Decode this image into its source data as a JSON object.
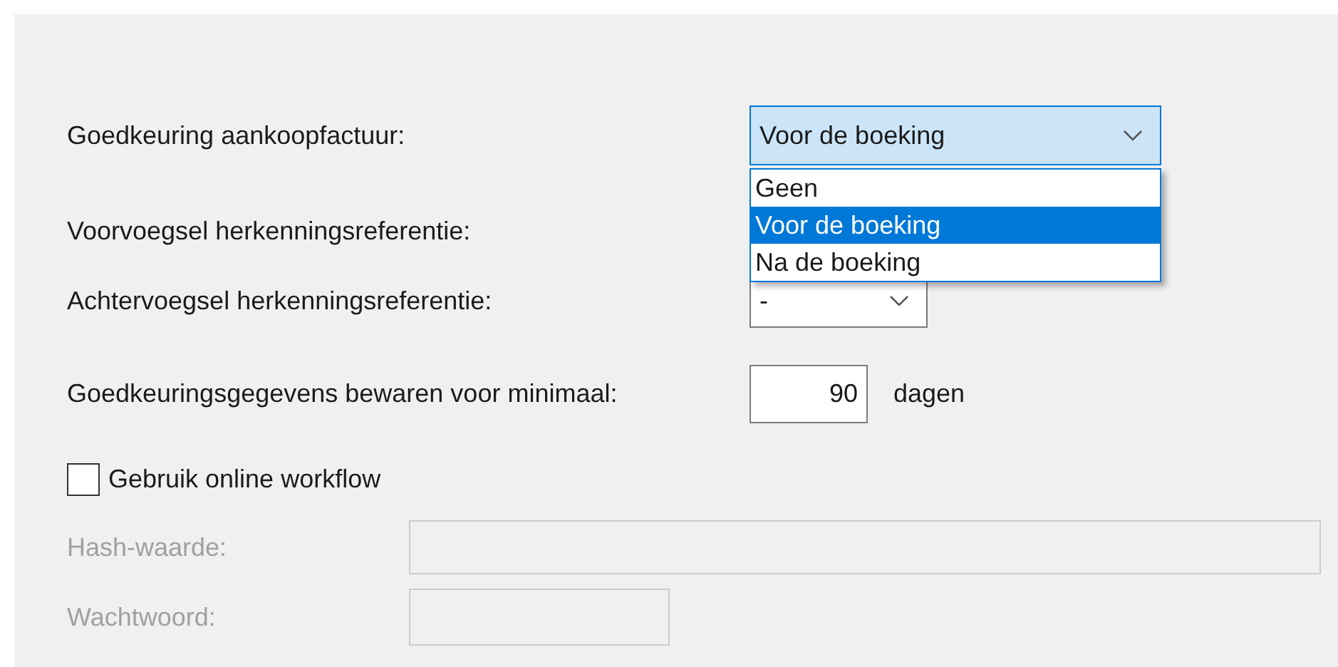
{
  "fields": [
    {
      "kind": "dropdown",
      "label": "Goedkeuring aankoopfactuur:",
      "value": "Voor de boeking",
      "expanded": true,
      "disabled": false,
      "options": [
        {
          "label": "Geen",
          "selected": false
        },
        {
          "label": "Voor de boeking",
          "selected": true
        },
        {
          "label": "Na de boeking",
          "selected": false
        }
      ]
    },
    {
      "kind": "label",
      "label": "Voorvoegsel herkenningsreferentie:",
      "disabled": false
    },
    {
      "kind": "dropdown",
      "label": "Achtervoegsel herkenningsreferentie:",
      "value": "-",
      "expanded": false,
      "disabled": false
    },
    {
      "kind": "number",
      "label": "Goedkeuringsgegevens bewaren voor minimaal:",
      "value": "90",
      "unit": "dagen",
      "disabled": false
    },
    {
      "kind": "checkbox",
      "label": "Gebruik online workflow",
      "checked": false,
      "disabled": false
    },
    {
      "kind": "text",
      "label": "Hash-waarde:",
      "disabled": true
    },
    {
      "kind": "password",
      "label": "Wachtwoord:",
      "disabled": true
    }
  ]
}
